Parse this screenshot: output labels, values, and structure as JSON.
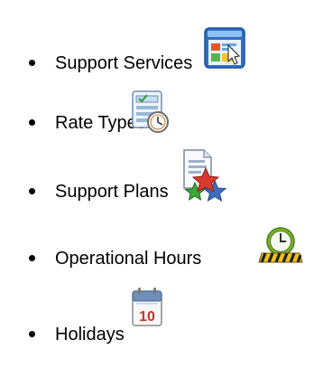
{
  "items": [
    {
      "label": "Support Services",
      "icon": "support-services-window-icon"
    },
    {
      "label": "Rate Types",
      "icon": "checklist-clock-icon"
    },
    {
      "label": "Support Plans",
      "icon": "document-stars-icon"
    },
    {
      "label": "Operational Hours",
      "icon": "clock-barrier-icon"
    },
    {
      "label": "Holidays",
      "icon": "calendar-icon"
    }
  ],
  "calendar_day": "10",
  "colors": {
    "text": "#000000",
    "background": "#ffffff",
    "window_blue": "#2f6fc4",
    "star_red": "#d83a2c",
    "star_green": "#3da83a",
    "star_blue": "#3c6fc0",
    "clock_green": "#7bb32e",
    "barrier_yellow": "#f2c318",
    "calendar_red": "#c8342a"
  }
}
